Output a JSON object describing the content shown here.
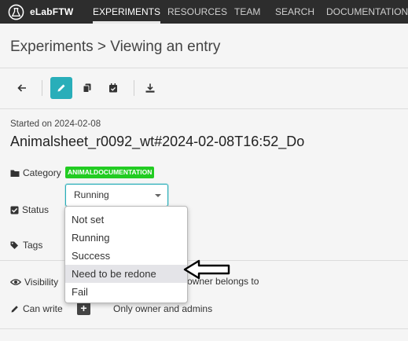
{
  "nav": {
    "brand": "eLabFTW",
    "items": [
      {
        "label": "EXPERIMENTS",
        "active": true
      },
      {
        "label": "RESOURCES",
        "active": false
      },
      {
        "label": "TEAM",
        "active": false
      },
      {
        "label": "SEARCH",
        "active": false
      },
      {
        "label": "DOCUMENTATION",
        "active": false
      }
    ]
  },
  "page": {
    "title": "Experiments > Viewing an entry"
  },
  "toolbar": {
    "buttons": [
      "back-arrow-icon",
      "pencil-icon",
      "duplicate-icon",
      "calendar-check-icon",
      "download-icon"
    ],
    "accent": "#29aeb9"
  },
  "entry": {
    "started": "Started on 2024-02-08",
    "title": "Animalsheet_r0092_wt#2024-02-08T16:52_Do"
  },
  "fields": {
    "category_label": "Category",
    "category_badge": "ANIMALDOCUMENTATION",
    "category_color": "#22cc22",
    "status_label": "Status",
    "status_value": "Running",
    "status_options": [
      "Not set",
      "Running",
      "Success",
      "Need to be redone",
      "Fail"
    ],
    "highlighted_option": "Need to be redone",
    "tags_label": "Tags",
    "visibility_label": "Visibility",
    "visibility_value": "owner belongs to",
    "canwrite_label": "Can write",
    "canwrite_value": "Only owner and admins",
    "plus": "+"
  }
}
